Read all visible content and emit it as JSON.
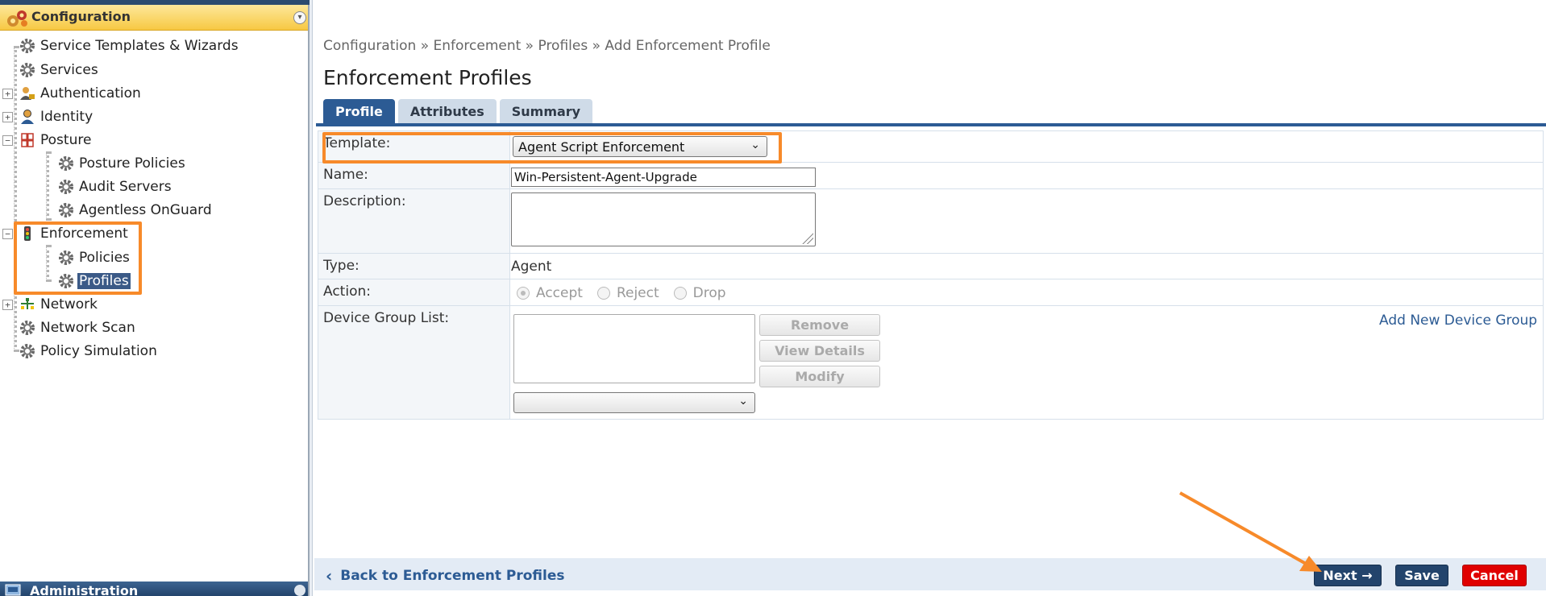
{
  "sidebar": {
    "header_title": "Configuration",
    "admin_title": "Administration",
    "items": [
      {
        "label": "Service Templates & Wizards",
        "icon": "gear-icon"
      },
      {
        "label": "Services",
        "icon": "gear-icon"
      },
      {
        "label": "Authentication",
        "icon": "user-lock-icon"
      },
      {
        "label": "Identity",
        "icon": "user-icon"
      },
      {
        "label": "Posture",
        "icon": "cross-shield-icon"
      },
      {
        "label": "Posture Policies",
        "icon": "gear-icon"
      },
      {
        "label": "Audit Servers",
        "icon": "gear-icon"
      },
      {
        "label": "Agentless OnGuard",
        "icon": "gear-icon"
      },
      {
        "label": "Enforcement",
        "icon": "traffic-light-icon"
      },
      {
        "label": "Policies",
        "icon": "gear-icon"
      },
      {
        "label": "Profiles",
        "icon": "gear-icon",
        "selected": true
      },
      {
        "label": "Network",
        "icon": "network-icon"
      },
      {
        "label": "Network Scan",
        "icon": "gear-icon"
      },
      {
        "label": "Policy Simulation",
        "icon": "gear-icon"
      }
    ],
    "expander_plus": "+",
    "expander_minus": "−"
  },
  "breadcrumb": "Configuration » Enforcement » Profiles » Add Enforcement Profile",
  "page_title": "Enforcement Profiles",
  "tabs": [
    {
      "label": "Profile",
      "active": true
    },
    {
      "label": "Attributes",
      "active": false
    },
    {
      "label": "Summary",
      "active": false
    }
  ],
  "form": {
    "template_label": "Template:",
    "template_value": "Agent Script Enforcement",
    "name_label": "Name:",
    "name_value": "Win-Persistent-Agent-Upgrade",
    "description_label": "Description:",
    "type_label": "Type:",
    "type_value": "Agent",
    "action_label": "Action:",
    "action_options": [
      "Accept",
      "Reject",
      "Drop"
    ],
    "action_selected": "Accept",
    "device_group_label": "Device Group List:",
    "remove_label": "Remove",
    "view_details_label": "View Details",
    "modify_label": "Modify",
    "add_device_group_label": "Add New Device Group"
  },
  "footer": {
    "back_label": "Back to Enforcement Profiles",
    "next_label": "Next →",
    "save_label": "Save",
    "cancel_label": "Cancel"
  },
  "colors": {
    "accent": "#2c5b94",
    "highlight": "#f78a2a",
    "cancel": "#e00000",
    "header_gold": "#f7c843"
  }
}
